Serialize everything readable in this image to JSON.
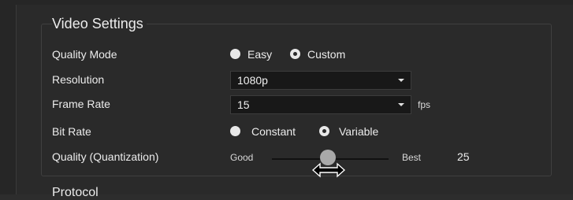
{
  "video_settings": {
    "title": "Video Settings",
    "quality_mode": {
      "label": "Quality Mode",
      "options": [
        "Easy",
        "Custom"
      ],
      "selected": "Custom"
    },
    "resolution": {
      "label": "Resolution",
      "value": "1080p"
    },
    "frame_rate": {
      "label": "Frame Rate",
      "value": "15",
      "unit": "fps"
    },
    "bit_rate": {
      "label": "Bit Rate",
      "options": [
        "Constant",
        "Variable"
      ],
      "selected": "Variable"
    },
    "quality_quantization": {
      "label": "Quality (Quantization)",
      "min_label": "Good",
      "max_label": "Best",
      "value": "25",
      "icon": "horizontal-resize-cursor-icon"
    }
  },
  "next_section_title": "Protocol",
  "colors": {
    "background": "#2a2a2a",
    "control_bg": "#181818",
    "text": "#ececec",
    "radio": "#e8e8e8",
    "slider_thumb": "#a9a9a9"
  }
}
